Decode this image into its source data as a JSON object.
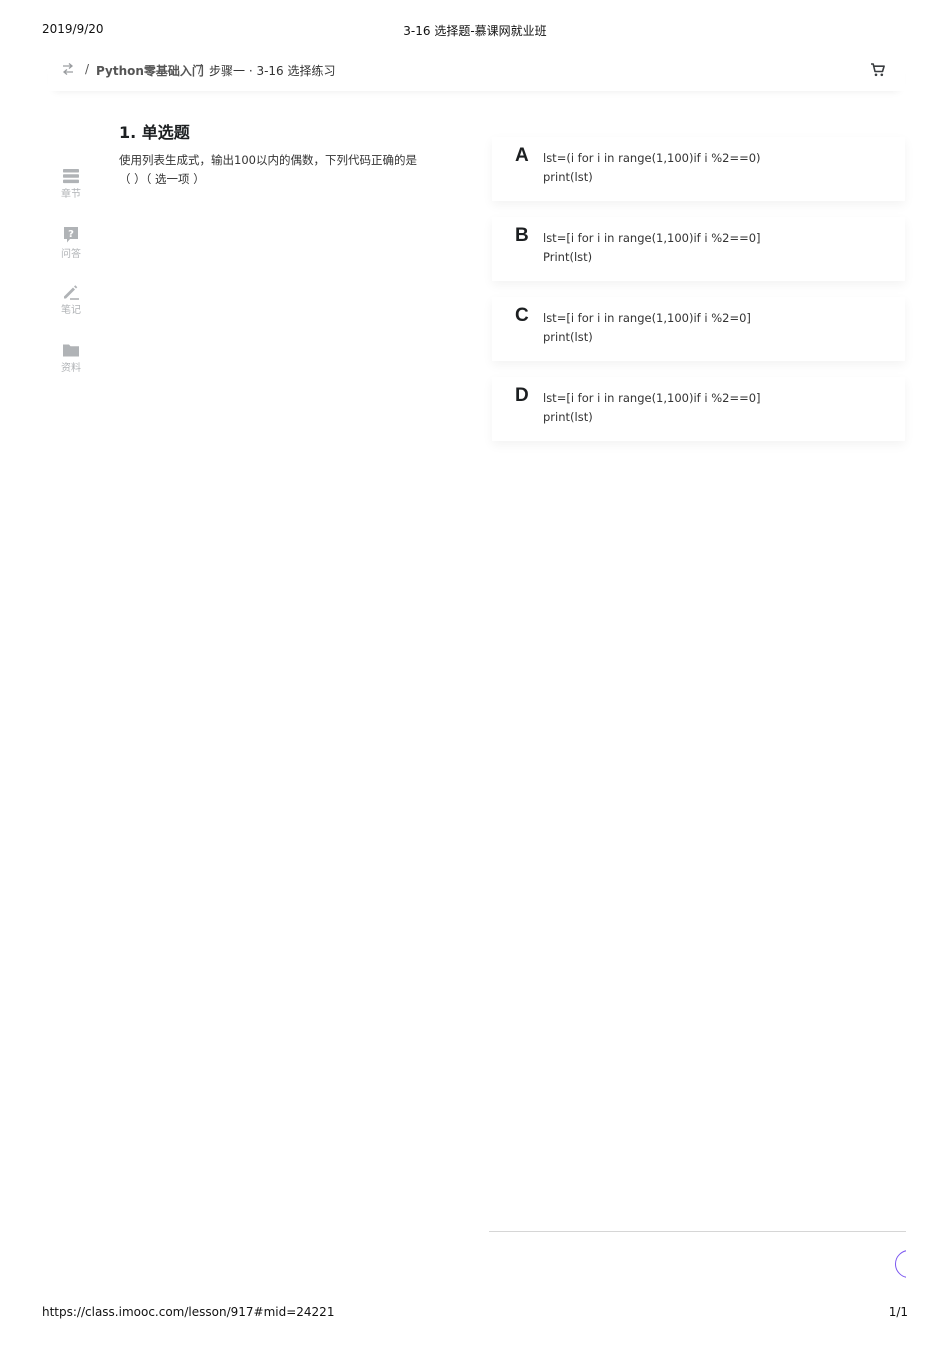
{
  "print_header": {
    "date": "2019/9/20",
    "title": "3-16 选择题-慕课网就业班"
  },
  "breadcrumb": {
    "separator": "/",
    "course": "Python零基础入门",
    "step": "步骤一 · 3-16 选择练习"
  },
  "sidebar": {
    "items": [
      {
        "label": "章节",
        "icon": "chapters-icon"
      },
      {
        "label": "问答",
        "icon": "question-icon"
      },
      {
        "label": "笔记",
        "icon": "pencil-icon"
      },
      {
        "label": "资料",
        "icon": "folder-icon"
      }
    ]
  },
  "question": {
    "number_title": "1. 单选题",
    "text": "使用列表生成式，输出100以内的偶数，下列代码正确的是（ ）（ 选一项 ）"
  },
  "options": [
    {
      "letter": "A",
      "code": "lst=(i for i in range(1,100)if i %2==0)\nprint(lst)"
    },
    {
      "letter": "B",
      "code": "lst=[i for i in range(1,100)if i %2==0]\nPrint(lst)"
    },
    {
      "letter": "C",
      "code": "lst=[i for i in range(1,100)if i %2=0]\nprint(lst)"
    },
    {
      "letter": "D",
      "code": "lst=[i for i in range(1,100)if i %2==0]\nprint(lst)"
    }
  ],
  "colors": {
    "accent": "#7b57f0",
    "icon_gray": "#b0b3b6",
    "text": "#1c1f21"
  },
  "print_footer": {
    "url": "https://class.imooc.com/lesson/917#mid=24221",
    "page": "1/1"
  }
}
